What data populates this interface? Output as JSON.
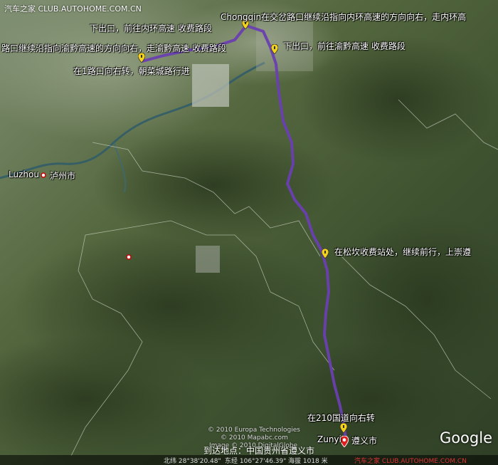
{
  "watermark_top": "汽车之家 CLUB.AUTOHOME.COM.CN",
  "watermark_bottom": "汽车之家 CLUB.AUTOHOME.COM.CN",
  "route_color": "#6a3fb0",
  "labels": {
    "chongqing_turn": "Chongqin在交岔路口继续沿指向内环高速的方向向右，走内环高",
    "exit_inner_ring": "下出口，前往内环高速 收费路段",
    "yuqian_turn": "路口继续沿指向渝黔高速的方向向右，走渝黔高速 收费路段",
    "exit_yuqian": "下出口，前往渝黔高速 收费路段",
    "road1_turn": "在1路口向右转，朝菜城路行进",
    "songkan_toll": "在松坎收费站处，继续前行，上崇遵",
    "national210": "在210国道向右转",
    "arrive": "到达地点：中国贵州省遵义市"
  },
  "cities": {
    "luzhou_en": "Luzhou",
    "luzhou_cn": "泸州市",
    "zunyi_en": "Zunyi",
    "zunyi_cn": "遵义市"
  },
  "copyright": {
    "line1": "© 2010 Europa Technologies",
    "line2": "© 2010 Mapabc.com",
    "line3": "Image © 2010 DigitalGlobe"
  },
  "google": "Google",
  "status": {
    "lat": "北纬 28°38'20.48\"",
    "lon": "东经 106°27'46.39\"",
    "elev": "海拔 1018 米"
  }
}
